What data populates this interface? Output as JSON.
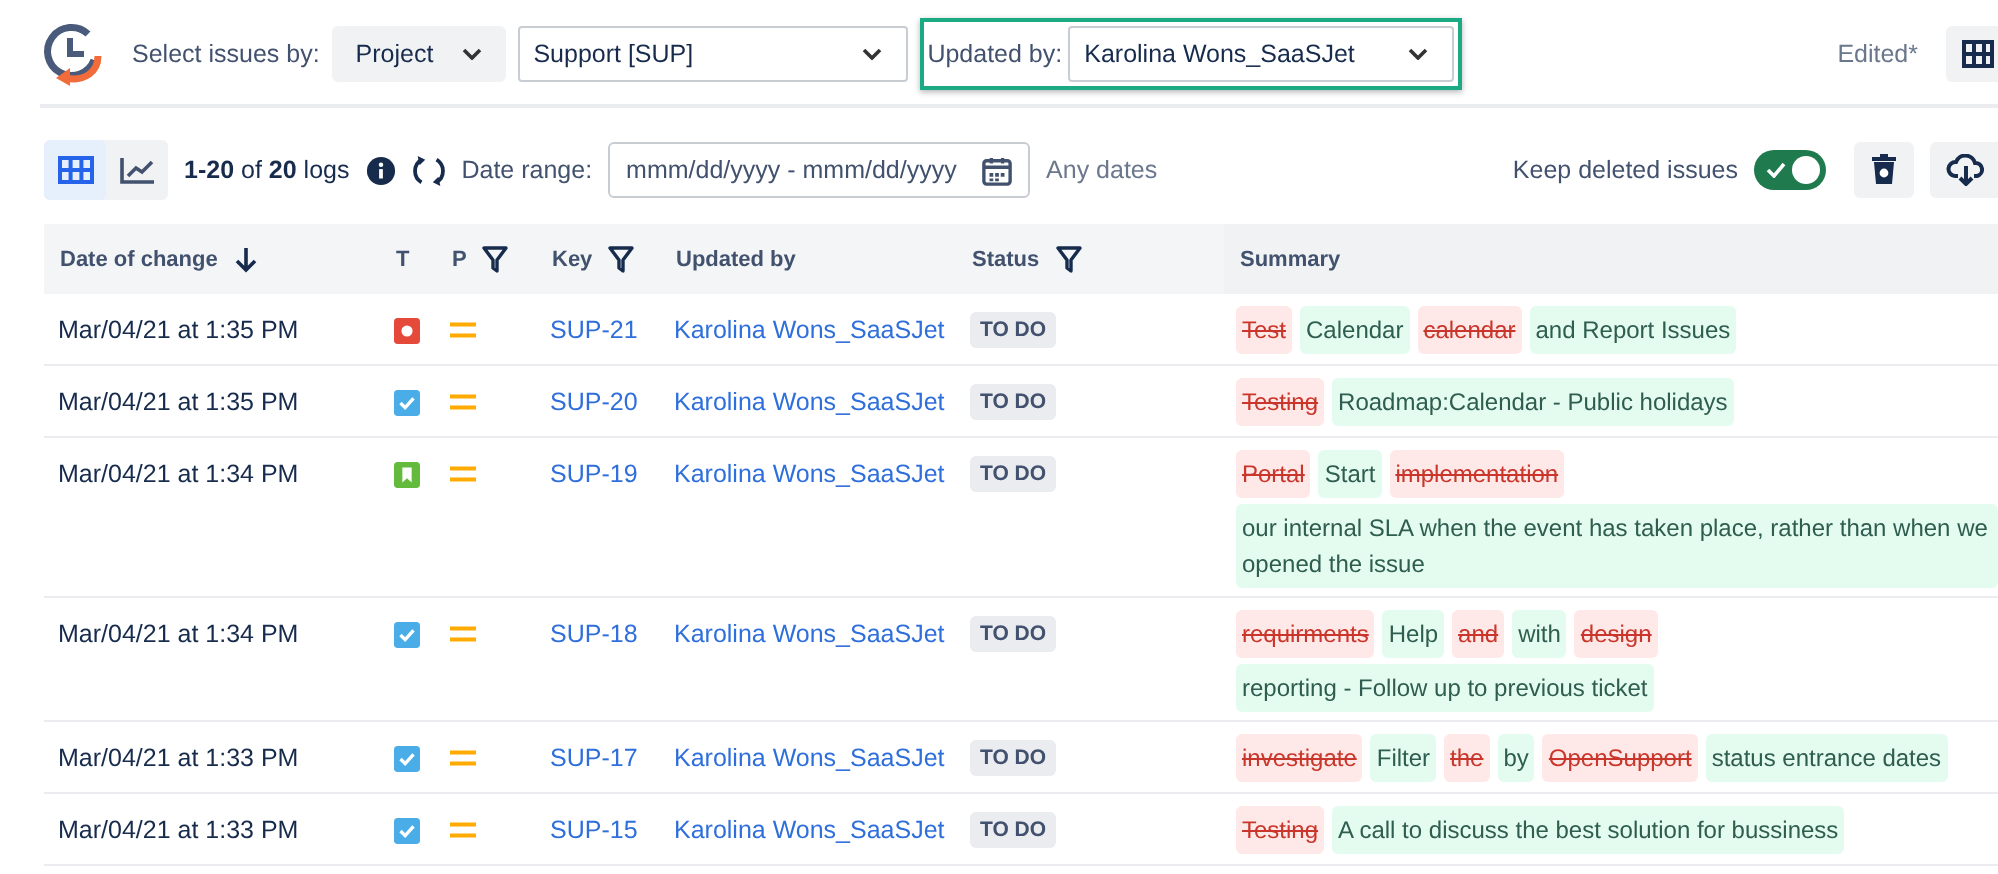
{
  "header": {
    "select_label": "Select issues by:",
    "scope_dropdown": "Project",
    "project_dropdown": "Support [SUP]",
    "updated_by_label": "Updated by:",
    "updated_by_dropdown": "Karolina Wons_SaaSJet",
    "edited": "Edited*"
  },
  "toolbar": {
    "views": [
      {
        "kind": "table",
        "selected": true
      },
      {
        "kind": "chart",
        "selected": false
      }
    ],
    "count": "**1-20** of **20** logs",
    "date_range_label": "Date range:",
    "date_range_placeholder": "mmm/dd/yyyy - mmm/dd/yyyy",
    "date_range_value": "Any dates",
    "keep_deleted_label": "Keep deleted issues",
    "keep_deleted_on": true
  },
  "table": {
    "columns": [
      {
        "label": "Date of change",
        "sorted": true,
        "filter": false
      },
      {
        "label": "T",
        "sorted": false,
        "filter": false
      },
      {
        "label": "P",
        "sorted": false,
        "filter": true
      },
      {
        "label": "Key",
        "sorted": false,
        "filter": true
      },
      {
        "label": "Updated by",
        "sorted": false,
        "filter": false
      },
      {
        "label": "Status",
        "sorted": false,
        "filter": true
      },
      {
        "label": "Summary",
        "sorted": false,
        "filter": false
      }
    ],
    "rows": [
      {
        "date": "Mar/04/21 at 1:35 PM",
        "type_icon": {
          "kind": "bug"
        },
        "priority_icon": {
          "kind": "medium"
        },
        "key": "SUP-21",
        "updated_by": "Karolina Wons_SaaSJet",
        "status": "TO DO",
        "summary": [
          {
            "text": "Test",
            "kind": "removed"
          },
          {
            "text": "Calendar",
            "kind": "added"
          },
          {
            "text": "calendar",
            "kind": "removed"
          },
          {
            "text": "and Report Issues",
            "kind": "added"
          }
        ]
      },
      {
        "date": "Mar/04/21 at 1:35 PM",
        "type_icon": {
          "kind": "task"
        },
        "priority_icon": {
          "kind": "medium"
        },
        "key": "SUP-20",
        "updated_by": "Karolina Wons_SaaSJet",
        "status": "TO DO",
        "summary": [
          {
            "text": "Testing",
            "kind": "removed"
          },
          {
            "text": "Roadmap:Calendar - Public holidays",
            "kind": "added"
          }
        ]
      },
      {
        "date": "Mar/04/21 at 1:34 PM",
        "type_icon": {
          "kind": "story"
        },
        "priority_icon": {
          "kind": "medium"
        },
        "key": "SUP-19",
        "updated_by": "Karolina Wons_SaaSJet",
        "status": "TO DO",
        "summary": [
          {
            "text": "Portal",
            "kind": "removed"
          },
          {
            "text": "Start",
            "kind": "added"
          },
          {
            "text": "implementation",
            "kind": "removed"
          },
          {
            "text": "our internal SLA when the event has taken place, rather than when we opened the issue",
            "kind": "added"
          }
        ]
      },
      {
        "date": "Mar/04/21 at 1:34 PM",
        "type_icon": {
          "kind": "task"
        },
        "priority_icon": {
          "kind": "medium"
        },
        "key": "SUP-18",
        "updated_by": "Karolina Wons_SaaSJet",
        "status": "TO DO",
        "summary": [
          {
            "text": "requirments",
            "kind": "removed"
          },
          {
            "text": "Help",
            "kind": "added"
          },
          {
            "text": "and",
            "kind": "removed"
          },
          {
            "text": "with",
            "kind": "added"
          },
          {
            "text": "design",
            "kind": "removed"
          },
          {
            "text": "reporting - Follow up to previous ticket",
            "kind": "added"
          }
        ]
      },
      {
        "date": "Mar/04/21 at 1:33 PM",
        "type_icon": {
          "kind": "task"
        },
        "priority_icon": {
          "kind": "medium"
        },
        "key": "SUP-17",
        "updated_by": "Karolina Wons_SaaSJet",
        "status": "TO DO",
        "summary": [
          {
            "text": "investigate",
            "kind": "removed"
          },
          {
            "text": "Filter",
            "kind": "added"
          },
          {
            "text": "the",
            "kind": "removed"
          },
          {
            "text": "by",
            "kind": "added"
          },
          {
            "text": "OpenSupport",
            "kind": "removed"
          },
          {
            "text": "status entrance dates",
            "kind": "added"
          }
        ]
      },
      {
        "date": "Mar/04/21 at 1:33 PM",
        "type_icon": {
          "kind": "task"
        },
        "priority_icon": {
          "kind": "medium"
        },
        "key": "SUP-15",
        "updated_by": "Karolina Wons_SaaSJet",
        "status": "TO DO",
        "summary": [
          {
            "text": "Testing",
            "kind": "removed"
          },
          {
            "text": "A call to discuss the best solution for bussiness",
            "kind": "added"
          }
        ]
      }
    ]
  }
}
